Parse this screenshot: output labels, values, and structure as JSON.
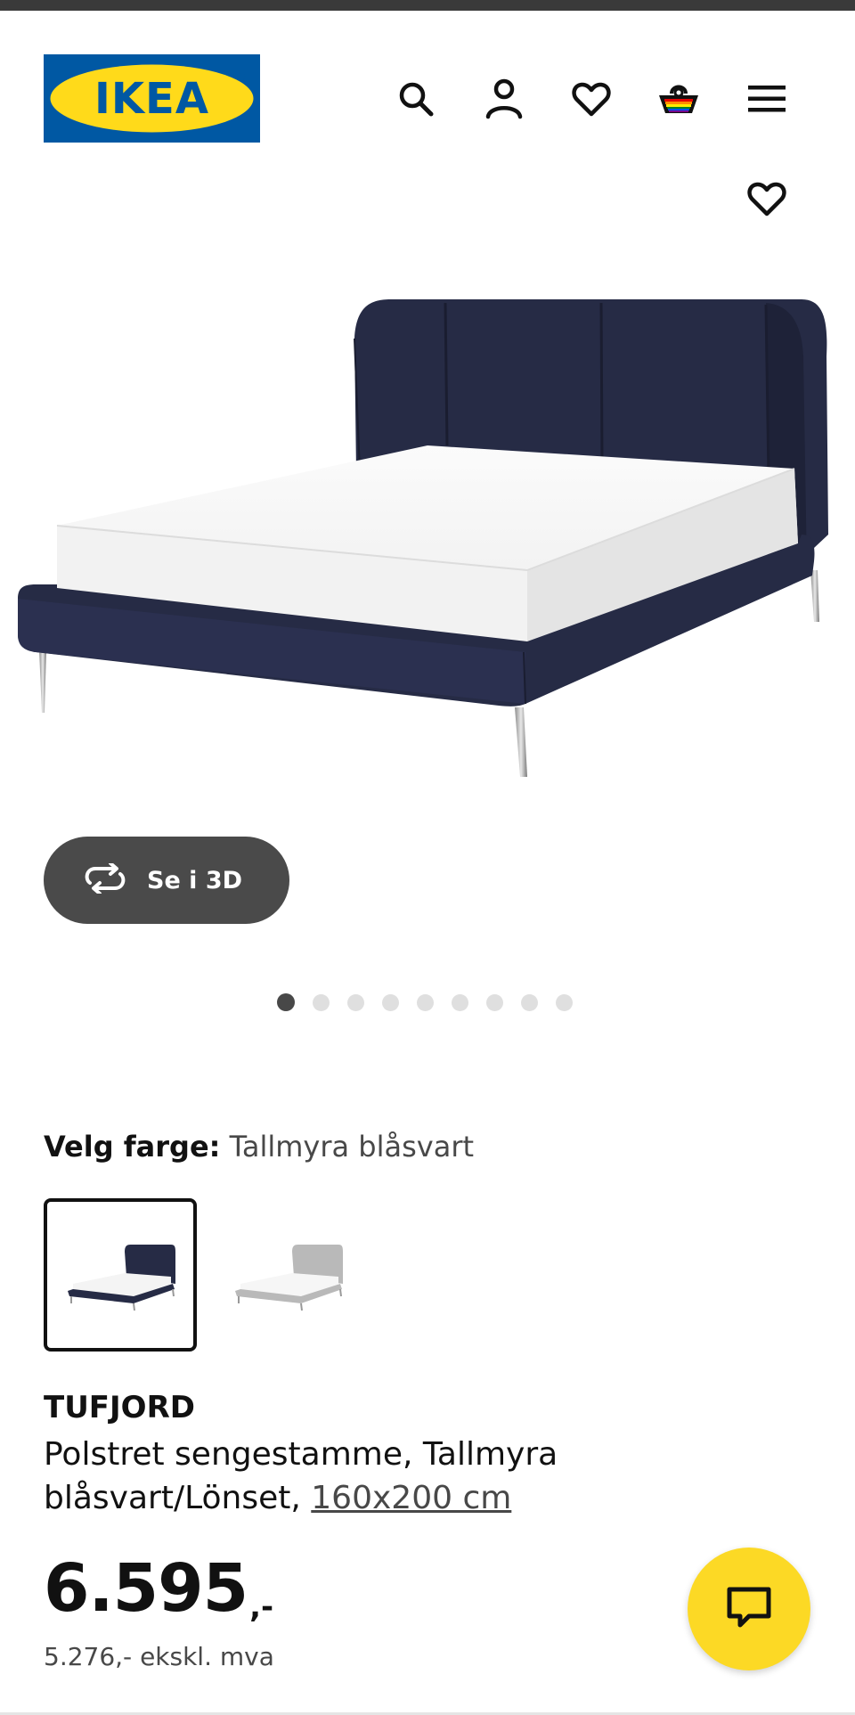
{
  "brand": {
    "logo_text": "IKEA",
    "logo_blue": "#0058a3",
    "logo_yellow": "#ffda1a"
  },
  "header": {
    "icons": [
      "search-icon",
      "profile-icon",
      "heart-icon",
      "shopping-bag-icon",
      "hamburger-menu-icon"
    ]
  },
  "gallery": {
    "image": "tufjord-bed-tallmyra-blasvart",
    "button_3d_label": "Se i 3D",
    "image_count": 9,
    "active_index": 1
  },
  "color_picker": {
    "label": "Velg farge:",
    "selected": "Tallmyra blåsvart",
    "swatches": [
      {
        "name": "Tallmyra blåsvart",
        "color": "#262b45",
        "selected": true
      },
      {
        "name": "grå",
        "color": "#b9b9b9",
        "selected": false
      }
    ]
  },
  "product": {
    "name": "TUFJORD",
    "description": "Polstret sengestamme, Tallmyra blåsvart/Lönset, ",
    "size_link": "160x200 cm",
    "price": "6.595",
    "price_suffix": ",-",
    "price_ex_vat": "5.276,- ekskl. mva"
  },
  "colors": {
    "chat_button": "#fcd925",
    "text_primary": "#111111",
    "text_secondary": "#484848",
    "button_dark": "#4a4a4a"
  }
}
